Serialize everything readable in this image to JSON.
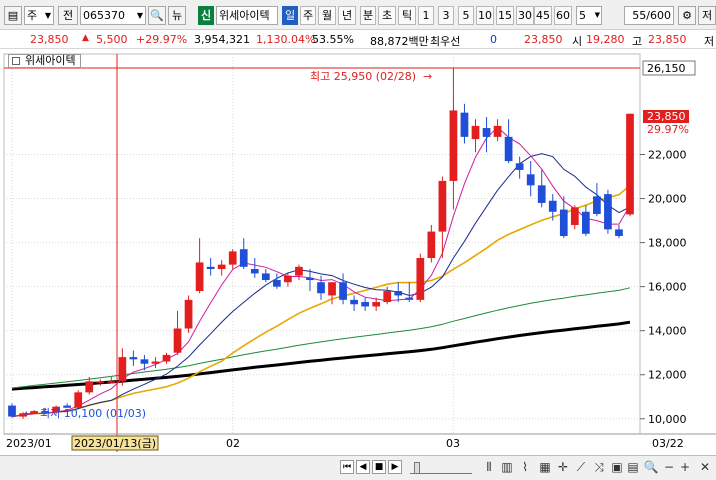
{
  "toolbar": {
    "type_select": "주",
    "prefix": "전",
    "code": "065370",
    "view_label": "뉴",
    "credit_label": "신",
    "name": "위세아이텍",
    "periods": [
      "일",
      "주",
      "월",
      "년",
      "분",
      "초",
      "틱"
    ],
    "active_period": "일",
    "intervals": [
      "1",
      "3",
      "5",
      "10",
      "15",
      "30",
      "45",
      "60"
    ],
    "interval_value": "5",
    "count": "55",
    "count_total": "/600",
    "save_label": "저"
  },
  "info": {
    "price": "23,850",
    "change": "5,500",
    "change_rate": "+29.97%",
    "volume": "3,954,321",
    "volume_rate": "1,130.04%",
    "turnover": "53.55%",
    "amount": "88,872백만",
    "bid_label": "최우선",
    "bid_value": "0",
    "ask_value": "23,850",
    "open_label": "시",
    "open_value": "19,280",
    "high_label": "고",
    "high_value": "23,850",
    "low_label": "저"
  },
  "chart": {
    "title": "위세아이텍",
    "high_marker": "최고 25,950 (02/28)",
    "low_marker": "최저 10,100 (01/03)",
    "crosshair_date": "2023/01/13(금)",
    "axis_top_label": "26,150",
    "cur_price_label": "23,850",
    "cur_rate_label": "29.97%",
    "y_ticks": [
      "22,000",
      "20,000",
      "18,000",
      "16,000",
      "14,000",
      "12,000",
      "10,000"
    ],
    "x_labels": [
      "2023/01",
      "02",
      "03",
      "03/22"
    ],
    "colors": {
      "up": "#e31e1e",
      "down": "#1f4fd8",
      "ma5": "#d21ca0",
      "ma10": "#1a2a8a",
      "ma20": "#e8a800",
      "ma60": "#1d8a3a",
      "ma120": "#000000"
    }
  },
  "chart_data": {
    "type": "candlestick",
    "ylim": [
      9400,
      26200
    ],
    "ohlc": [
      [
        10600,
        10700,
        10050,
        10100
      ],
      [
        10100,
        10300,
        10000,
        10250
      ],
      [
        10250,
        10400,
        10200,
        10350
      ],
      [
        10350,
        10500,
        10200,
        10300
      ],
      [
        10300,
        10600,
        10200,
        10550
      ],
      [
        10600,
        10700,
        10500,
        10500
      ],
      [
        10500,
        11300,
        10500,
        11200
      ],
      [
        11200,
        11900,
        11100,
        11700
      ],
      [
        11700,
        11800,
        11500,
        11700
      ],
      [
        11700,
        11900,
        11600,
        11700
      ],
      [
        11700,
        13200,
        11500,
        12800
      ],
      [
        12800,
        13100,
        12400,
        12700
      ],
      [
        12700,
        12900,
        12200,
        12500
      ],
      [
        12500,
        12800,
        12300,
        12600
      ],
      [
        12600,
        13000,
        12500,
        12900
      ],
      [
        13000,
        14900,
        12900,
        14100
      ],
      [
        14100,
        15600,
        13900,
        15400
      ],
      [
        15800,
        18200,
        15700,
        17100
      ],
      [
        16900,
        17300,
        16500,
        16800
      ],
      [
        16800,
        17200,
        16500,
        17000
      ],
      [
        17000,
        17700,
        16800,
        17600
      ],
      [
        17700,
        18200,
        16800,
        16900
      ],
      [
        16800,
        17300,
        16400,
        16600
      ],
      [
        16600,
        16800,
        16200,
        16300
      ],
      [
        16300,
        16600,
        15900,
        16000
      ],
      [
        16200,
        16600,
        16000,
        16500
      ],
      [
        16500,
        17000,
        16300,
        16900
      ],
      [
        16400,
        16800,
        15800,
        16300
      ],
      [
        16200,
        16500,
        15400,
        15700
      ],
      [
        15600,
        16200,
        15200,
        16200
      ],
      [
        16200,
        16600,
        15200,
        15400
      ],
      [
        15400,
        15600,
        14900,
        15200
      ],
      [
        15300,
        15500,
        14900,
        15100
      ],
      [
        15100,
        15500,
        14900,
        15300
      ],
      [
        15300,
        16000,
        15200,
        15800
      ],
      [
        15800,
        16200,
        15300,
        15600
      ],
      [
        15500,
        16200,
        15300,
        15400
      ],
      [
        15400,
        17500,
        15300,
        17300
      ],
      [
        17300,
        18800,
        17100,
        18500
      ],
      [
        18500,
        21000,
        17300,
        20800
      ],
      [
        20800,
        25950,
        19500,
        24000
      ],
      [
        23900,
        24300,
        22500,
        22800
      ],
      [
        22700,
        23600,
        22100,
        23300
      ],
      [
        23200,
        23700,
        22100,
        22800
      ],
      [
        22800,
        23600,
        22600,
        23300
      ],
      [
        22800,
        23600,
        21600,
        21700
      ],
      [
        21600,
        21900,
        20900,
        21300
      ],
      [
        21100,
        21700,
        20100,
        20600
      ],
      [
        20600,
        21300,
        19600,
        19800
      ],
      [
        19900,
        20200,
        19000,
        19400
      ],
      [
        19500,
        20100,
        18200,
        18300
      ],
      [
        18800,
        19700,
        18600,
        19600
      ],
      [
        19400,
        19700,
        18300,
        18400
      ],
      [
        20100,
        20700,
        19200,
        19300
      ],
      [
        20200,
        20400,
        18400,
        18600
      ],
      [
        18600,
        18800,
        18200,
        18300
      ],
      [
        19280,
        23850,
        19200,
        23850
      ]
    ]
  },
  "bottombar": {
    "zoom_out": "−",
    "zoom_in": "+",
    "close": "✕"
  }
}
